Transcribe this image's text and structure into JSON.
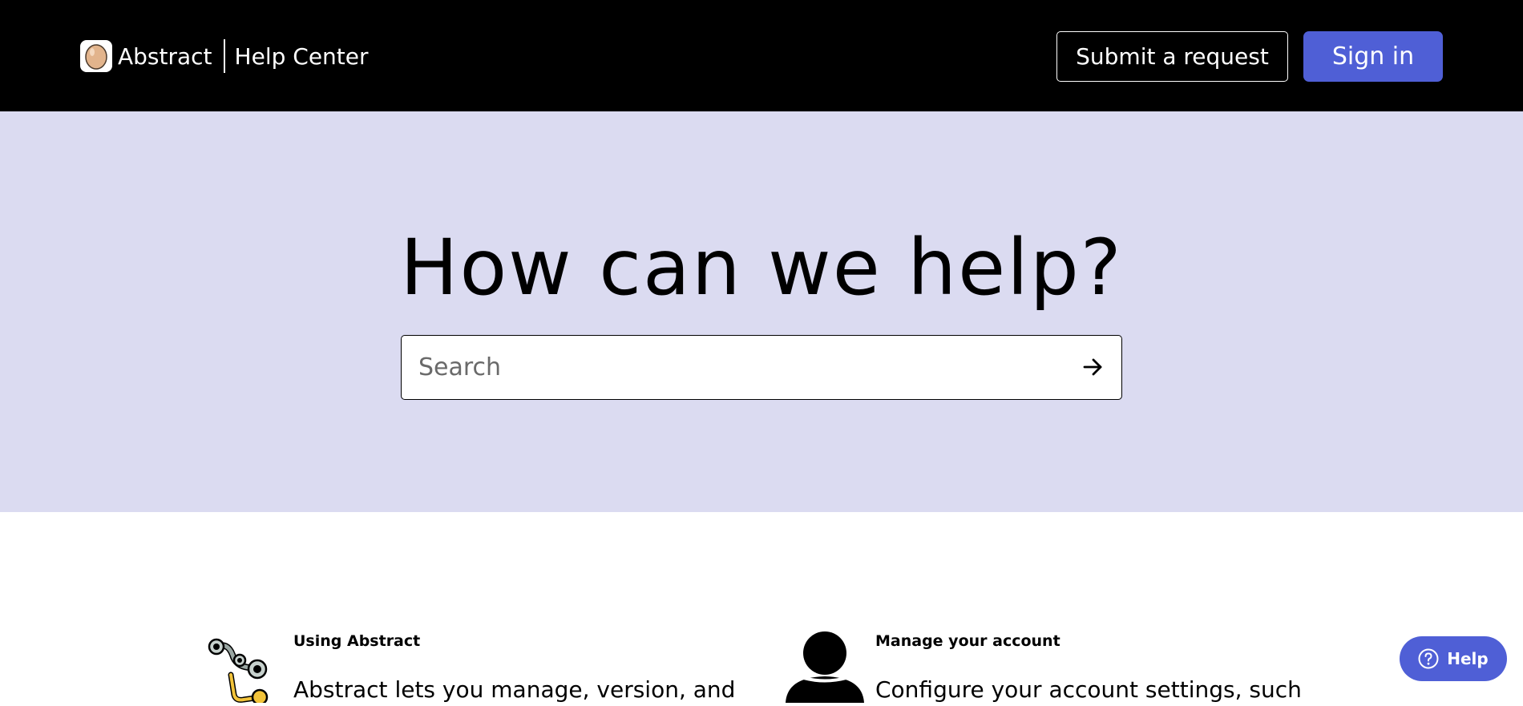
{
  "header": {
    "brand_name": "Abstract",
    "brand_sub": "Help Center",
    "submit_request_label": "Submit a request",
    "sign_in_label": "Sign in"
  },
  "hero": {
    "title": "How can we help?",
    "search_placeholder": "Search",
    "search_value": ""
  },
  "categories": [
    {
      "title": "Using Abstract",
      "description": "Abstract lets you manage, version, and",
      "icon": "robot-arm-icon"
    },
    {
      "title": "Manage your account",
      "description": "Configure your account settings, such",
      "icon": "person-icon"
    }
  ],
  "help_widget": {
    "label": "Help",
    "icon": "question-circle-icon"
  },
  "colors": {
    "header_bg": "#000000",
    "hero_bg": "#dbdbf1",
    "accent": "#4f5fd6"
  }
}
